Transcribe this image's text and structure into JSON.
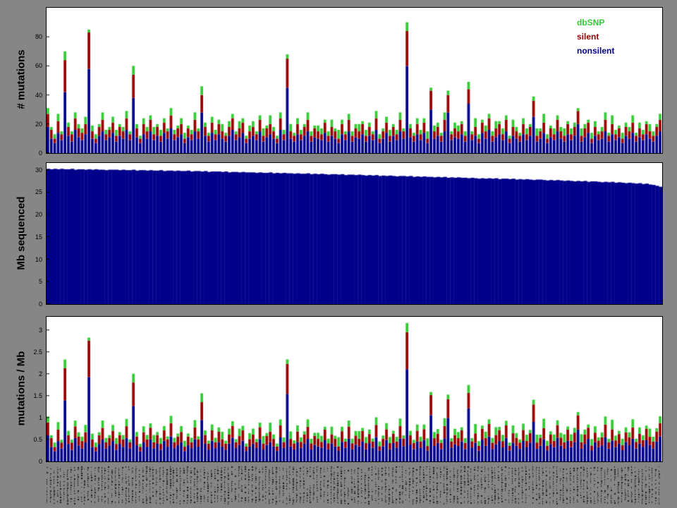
{
  "figure": {
    "background": "#868686",
    "panel_background": "#ffffff",
    "border_color": "#000000"
  },
  "legend": {
    "items": [
      {
        "label": "dbSNP",
        "color": "#33cc33"
      },
      {
        "label": "silent",
        "color": "#990000"
      },
      {
        "label": "nonsilent",
        "color": "#00008b"
      }
    ]
  },
  "panels": [
    {
      "ylabel": "# mutations",
      "ymax": 100,
      "yticks": [
        0,
        20,
        40,
        60,
        80
      ]
    },
    {
      "ylabel": "Mb sequenced",
      "ymax": 31.5,
      "yticks": [
        0,
        5,
        10,
        15,
        20,
        25,
        30
      ]
    },
    {
      "ylabel": "mutations / Mb",
      "ymax": 3.3,
      "yticks": [
        0,
        0.5,
        1,
        1.5,
        2,
        2.5,
        3
      ]
    }
  ],
  "chart_data": {
    "type": "bar",
    "stacked": true,
    "n_samples": 180,
    "description": "Three vertically stacked panels over the same tumor samples: stacked mutation counts (nonsilent/silent/dbSNP), Mb sequenced per sample, and mutation rate per Mb (counts divided by Mb). Sample labels along the bottom are too small to be legible.",
    "series_colors": {
      "nonsilent": "#00008b",
      "silent": "#990000",
      "dbSNP": "#33cc33"
    },
    "panel1": {
      "title": "# mutations",
      "series": [
        {
          "name": "nonsilent",
          "values": [
            18,
            10,
            7,
            14,
            9,
            42,
            12,
            8,
            16,
            11,
            9,
            13,
            58,
            10,
            7,
            12,
            15,
            9,
            11,
            14,
            8,
            12,
            10,
            16,
            9,
            38,
            11,
            7,
            13,
            10,
            15,
            9,
            12,
            8,
            14,
            10,
            17,
            9,
            11,
            13,
            7,
            11,
            9,
            15,
            10,
            28,
            12,
            8,
            14,
            9,
            13,
            10,
            8,
            12,
            16,
            9,
            11,
            14,
            7,
            10,
            12,
            9,
            15,
            8,
            11,
            13,
            10,
            7,
            16,
            9,
            45,
            10,
            8,
            13,
            9,
            12,
            15,
            8,
            11,
            10,
            9,
            14,
            8,
            12,
            10,
            7,
            13,
            9,
            15,
            8,
            11,
            10,
            13,
            8,
            12,
            9,
            16,
            7,
            10,
            14,
            8,
            12,
            9,
            15,
            10,
            60,
            11,
            8,
            13,
            9,
            14,
            7,
            30,
            10,
            12,
            8,
            15,
            28,
            9,
            11,
            10,
            13,
            8,
            34,
            9,
            12,
            7,
            14,
            10,
            16,
            8,
            11,
            13,
            9,
            15,
            7,
            12,
            10,
            8,
            13,
            9,
            12,
            25,
            8,
            10,
            14,
            7,
            11,
            9,
            15,
            10,
            8,
            13,
            9,
            12,
            20,
            8,
            11,
            14,
            7,
            12,
            9,
            10,
            15,
            8,
            13,
            9,
            11,
            7,
            12,
            10,
            14,
            8,
            11,
            9,
            13,
            10,
            8,
            12,
            15
          ]
        },
        {
          "name": "silent",
          "values": [
            9,
            6,
            3,
            8,
            4,
            22,
            6,
            5,
            8,
            6,
            5,
            7,
            25,
            5,
            3,
            6,
            8,
            4,
            5,
            7,
            4,
            6,
            5,
            8,
            4,
            16,
            6,
            3,
            7,
            5,
            8,
            4,
            6,
            4,
            7,
            5,
            9,
            4,
            6,
            7,
            3,
            6,
            4,
            8,
            5,
            12,
            6,
            4,
            7,
            4,
            7,
            5,
            4,
            6,
            8,
            4,
            6,
            7,
            3,
            5,
            6,
            4,
            8,
            4,
            6,
            7,
            5,
            3,
            8,
            4,
            20,
            5,
            4,
            7,
            4,
            6,
            8,
            4,
            6,
            5,
            4,
            7,
            4,
            6,
            5,
            3,
            7,
            4,
            8,
            4,
            6,
            5,
            7,
            4,
            6,
            4,
            8,
            3,
            5,
            7,
            4,
            6,
            4,
            8,
            5,
            24,
            6,
            4,
            7,
            4,
            7,
            3,
            13,
            5,
            6,
            4,
            8,
            12,
            4,
            6,
            5,
            7,
            4,
            10,
            4,
            6,
            3,
            7,
            5,
            8,
            4,
            6,
            7,
            4,
            8,
            3,
            6,
            5,
            4,
            7,
            4,
            6,
            11,
            4,
            5,
            7,
            3,
            6,
            4,
            8,
            5,
            4,
            7,
            4,
            6,
            9,
            4,
            6,
            7,
            3,
            6,
            4,
            5,
            8,
            4,
            7,
            4,
            6,
            3,
            6,
            5,
            7,
            4,
            6,
            4,
            7,
            5,
            4,
            6,
            8
          ]
        },
        {
          "name": "dbSNP",
          "values": [
            4,
            2,
            3,
            5,
            2,
            6,
            3,
            2,
            4,
            3,
            3,
            5,
            2,
            4,
            3,
            2,
            5,
            3,
            2,
            4,
            4,
            2,
            3,
            5,
            2,
            6,
            3,
            2,
            4,
            3,
            3,
            5,
            2,
            4,
            3,
            2,
            5,
            3,
            2,
            4,
            4,
            2,
            3,
            5,
            2,
            6,
            3,
            2,
            4,
            3,
            3,
            5,
            2,
            4,
            3,
            2,
            5,
            3,
            2,
            4,
            4,
            2,
            3,
            5,
            2,
            6,
            3,
            2,
            4,
            3,
            3,
            5,
            2,
            4,
            3,
            2,
            5,
            3,
            2,
            4,
            4,
            2,
            3,
            5,
            2,
            6,
            3,
            2,
            4,
            3,
            3,
            5,
            2,
            4,
            3,
            2,
            5,
            3,
            2,
            4,
            4,
            2,
            3,
            5,
            2,
            6,
            3,
            2,
            4,
            3,
            3,
            5,
            2,
            4,
            3,
            2,
            5,
            3,
            2,
            4,
            4,
            2,
            3,
            5,
            2,
            6,
            3,
            2,
            4,
            3,
            3,
            5,
            2,
            4,
            3,
            2,
            5,
            3,
            2,
            4,
            4,
            2,
            3,
            5,
            2,
            6,
            3,
            2,
            4,
            3,
            3,
            5,
            2,
            4,
            3,
            2,
            5,
            3,
            2,
            4,
            4,
            2,
            3,
            5,
            2,
            6,
            3,
            2,
            4,
            3,
            3,
            5,
            2,
            4,
            3,
            2,
            5,
            3,
            2,
            4
          ]
        }
      ]
    },
    "panel2": {
      "title": "Mb sequenced",
      "series": [
        {
          "name": "Mb",
          "values": [
            30.2,
            30.1,
            30.2,
            30.1,
            30.2,
            30.1,
            30.1,
            30.2,
            30.0,
            30.1,
            30.1,
            30.0,
            30.1,
            30.0,
            30.1,
            30.0,
            30.0,
            29.9,
            30.0,
            30.0,
            30.0,
            29.9,
            30.0,
            29.9,
            29.9,
            30.0,
            29.8,
            29.9,
            29.9,
            29.8,
            29.9,
            29.8,
            29.8,
            29.9,
            29.7,
            29.8,
            29.8,
            29.7,
            29.8,
            29.7,
            29.7,
            29.8,
            29.6,
            29.7,
            29.7,
            29.6,
            29.7,
            29.5,
            29.6,
            29.6,
            29.6,
            29.5,
            29.6,
            29.4,
            29.5,
            29.5,
            29.4,
            29.5,
            29.4,
            29.4,
            29.4,
            29.3,
            29.4,
            29.3,
            29.3,
            29.4,
            29.2,
            29.3,
            29.2,
            29.3,
            29.2,
            29.2,
            29.1,
            29.2,
            29.1,
            29.1,
            29.2,
            29.0,
            29.1,
            29.0,
            29.1,
            29.0,
            28.9,
            29.0,
            29.0,
            28.9,
            29.0,
            28.8,
            28.9,
            28.9,
            28.8,
            28.9,
            28.8,
            28.7,
            28.8,
            28.7,
            28.8,
            28.6,
            28.7,
            28.6,
            28.7,
            28.6,
            28.5,
            28.6,
            28.6,
            28.5,
            28.6,
            28.4,
            28.5,
            28.4,
            28.5,
            28.4,
            28.4,
            28.3,
            28.4,
            28.3,
            28.4,
            28.2,
            28.3,
            28.2,
            28.3,
            28.2,
            28.2,
            28.1,
            28.2,
            28.1,
            28.0,
            28.1,
            28.0,
            28.1,
            28.0,
            28.1,
            27.9,
            28.0,
            28.0,
            27.9,
            28.0,
            27.8,
            27.9,
            27.8,
            27.9,
            27.8,
            27.7,
            27.8,
            27.8,
            27.7,
            27.6,
            27.7,
            27.6,
            27.7,
            27.6,
            27.5,
            27.6,
            27.5,
            27.4,
            27.5,
            27.4,
            27.5,
            27.3,
            27.4,
            27.4,
            27.3,
            27.2,
            27.3,
            27.2,
            27.3,
            27.1,
            27.2,
            27.1,
            27.0,
            27.1,
            27.0,
            26.9,
            27.0,
            26.8,
            26.9,
            26.7,
            26.6,
            26.4,
            26.2
          ]
        }
      ]
    },
    "panel3": {
      "title": "mutations / Mb",
      "derived_from": "panel1 stacked counts divided per-sample by panel2 Mb sequenced"
    }
  },
  "sample_axis": {
    "note": "dense vertical sample labels, illegible at this scale",
    "color": "#1a1a1a"
  }
}
